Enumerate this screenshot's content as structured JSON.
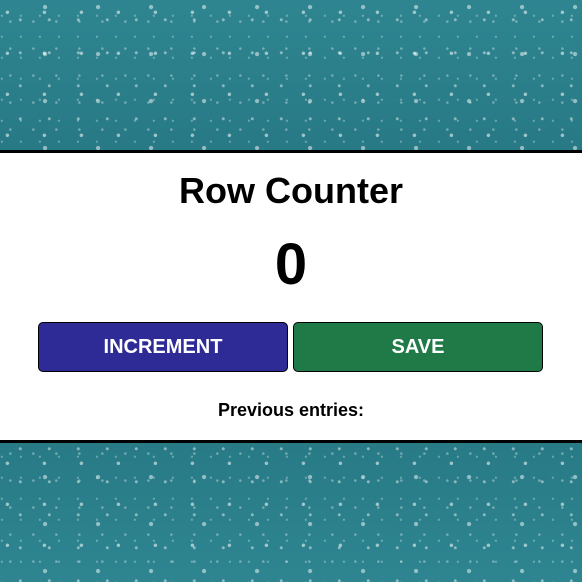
{
  "app": {
    "title": "Row Counter",
    "counter_value": "0"
  },
  "actions": {
    "increment_label": "INCREMENT",
    "save_label": "SAVE"
  },
  "entries": {
    "heading": "Previous entries:",
    "items": []
  },
  "colors": {
    "increment_button": "#2e2a96",
    "save_button": "#1f7a48",
    "background": "#2c7f8a",
    "panel": "#ffffff"
  }
}
